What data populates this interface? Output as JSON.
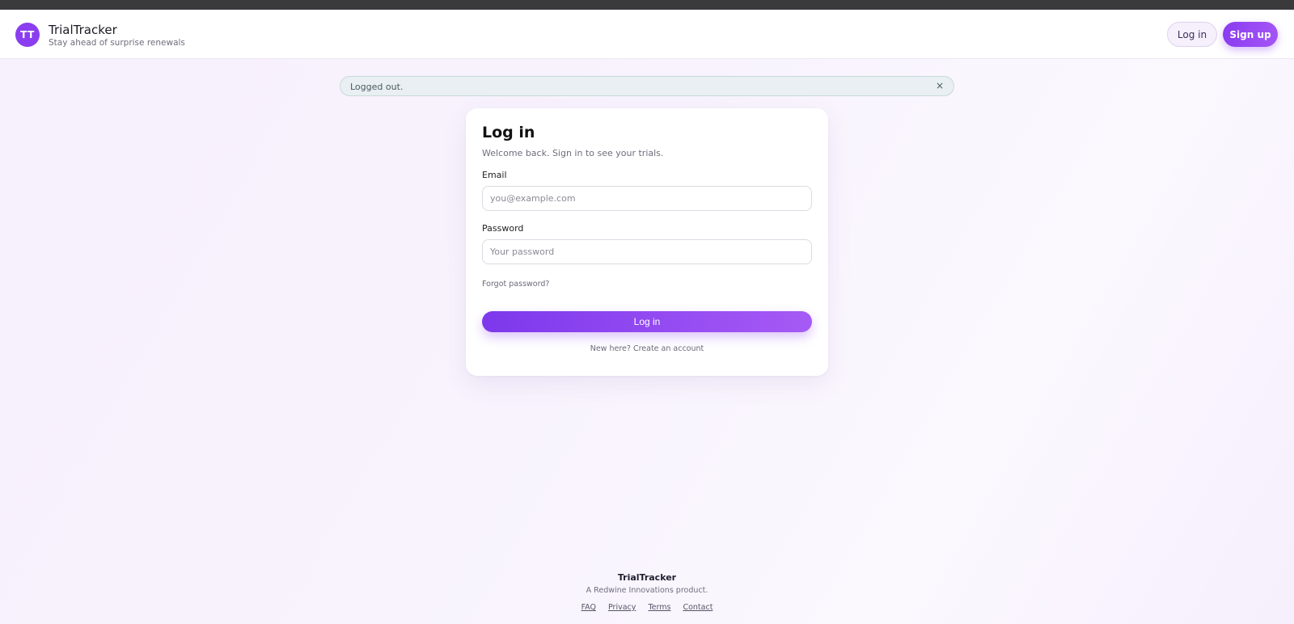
{
  "header": {
    "logo_initials": "TT",
    "brand_name": "TrialTracker",
    "tagline": "Stay ahead of surprise renewals",
    "login_label": "Log in",
    "signup_label": "Sign up"
  },
  "flash": {
    "message": "Logged out.",
    "close_glyph": "×"
  },
  "login_card": {
    "title": "Log in",
    "subtitle": "Welcome back. Sign in to see your trials.",
    "email_label": "Email",
    "email_placeholder": "you@example.com",
    "email_value": "",
    "password_label": "Password",
    "password_placeholder": "Your password",
    "password_value": "",
    "forgot_password": "Forgot password?",
    "submit_label": "Log in",
    "signup_prompt": "New here? Create an account"
  },
  "footer": {
    "brand": "TrialTracker",
    "tagline": "A Redwine Innovations product.",
    "links": [
      "FAQ",
      "Privacy",
      "Terms",
      "Contact"
    ]
  },
  "colors": {
    "accent": "#8b3ef0",
    "accent_light": "#a65af5",
    "flash_bg": "#e9eff2"
  }
}
